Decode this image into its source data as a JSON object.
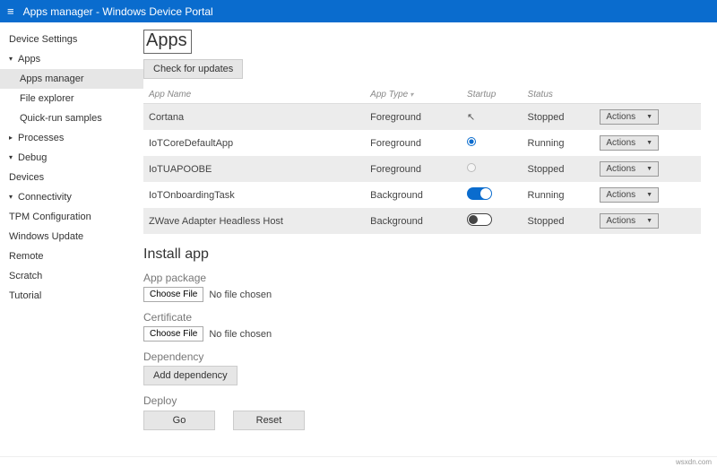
{
  "titlebar": {
    "text": "Apps manager - Windows Device Portal"
  },
  "sidebar": [
    {
      "label": "Device Settings",
      "kind": "top"
    },
    {
      "label": "Apps",
      "kind": "top-open"
    },
    {
      "label": "Apps manager",
      "kind": "child",
      "active": true
    },
    {
      "label": "File explorer",
      "kind": "child"
    },
    {
      "label": "Quick-run samples",
      "kind": "child"
    },
    {
      "label": "Processes",
      "kind": "top"
    },
    {
      "label": "Debug",
      "kind": "top-open"
    },
    {
      "label": "Devices",
      "kind": "top-plain"
    },
    {
      "label": "Connectivity",
      "kind": "top-open"
    },
    {
      "label": "TPM Configuration",
      "kind": "top-plain"
    },
    {
      "label": "Windows Update",
      "kind": "top-plain"
    },
    {
      "label": "Remote",
      "kind": "top-plain"
    },
    {
      "label": "Scratch",
      "kind": "top-plain"
    },
    {
      "label": "Tutorial",
      "kind": "top-plain"
    }
  ],
  "page": {
    "title": "Apps",
    "check_updates": "Check for updates",
    "columns": {
      "name": "App Name",
      "type": "App Type",
      "startup": "Startup",
      "status": "Status",
      "actions": "Actions"
    },
    "rows": [
      {
        "name": "Cortana",
        "type": "Foreground",
        "startup": "cursor",
        "status": "Stopped"
      },
      {
        "name": "IoTCoreDefaultApp",
        "type": "Foreground",
        "startup": "radio-on",
        "status": "Running"
      },
      {
        "name": "IoTUAPOOBE",
        "type": "Foreground",
        "startup": "radio-off",
        "status": "Stopped"
      },
      {
        "name": "IoTOnboardingTask",
        "type": "Background",
        "startup": "toggle-on",
        "status": "Running"
      },
      {
        "name": "ZWave Adapter Headless Host",
        "type": "Background",
        "startup": "toggle-off",
        "status": "Stopped"
      }
    ],
    "install": {
      "title": "Install app",
      "pkg_label": "App package",
      "cert_label": "Certificate",
      "choose_file": "Choose File",
      "no_file": "No file chosen",
      "dep_label": "Dependency",
      "add_dep": "Add dependency",
      "deploy_label": "Deploy",
      "go": "Go",
      "reset": "Reset"
    }
  },
  "footer": {
    "watermark": "wsxdn.com"
  }
}
